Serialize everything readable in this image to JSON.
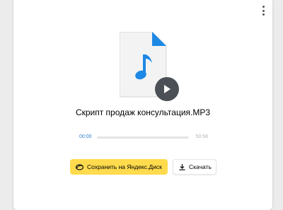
{
  "file": {
    "name": "Скрипт продаж консультация.MP3",
    "type_icon": "music-note-icon"
  },
  "player": {
    "current_time": "00:00",
    "total_time": "50:58",
    "progress": 0
  },
  "actions": {
    "save_label": "Сохранить на Яндекс.Диск",
    "download_label": "Скачать"
  },
  "colors": {
    "accent": "#ffdb4d",
    "file_icon": "#1e88e5",
    "progress": "#2f7fd6"
  }
}
